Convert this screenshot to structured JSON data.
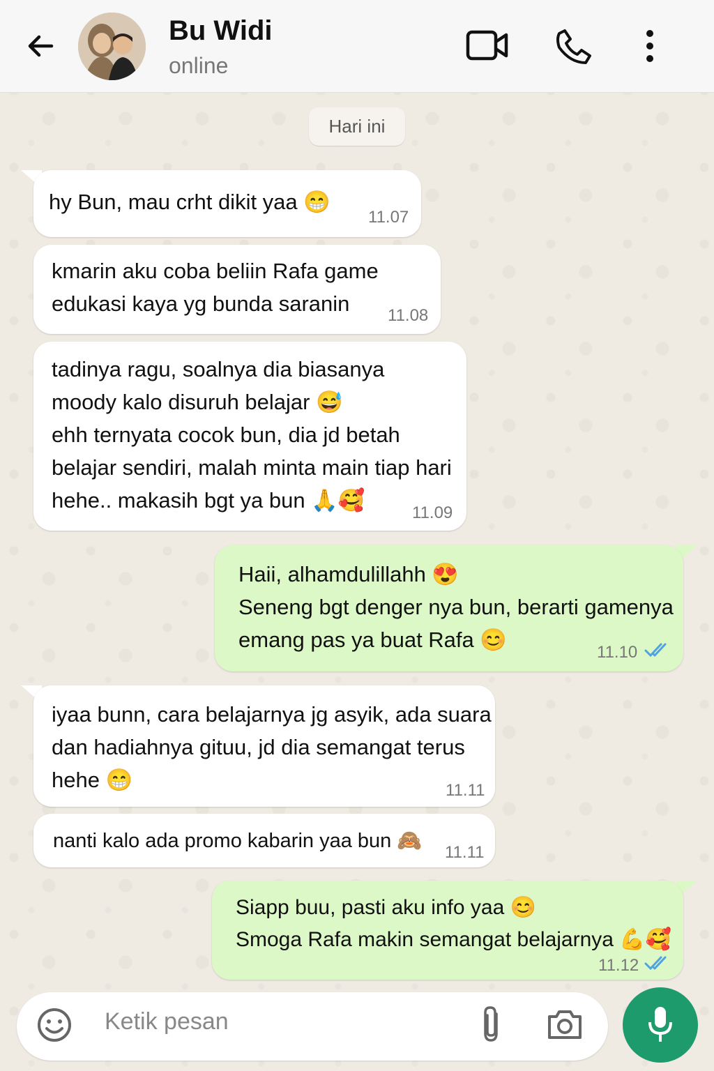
{
  "header": {
    "contact_name": "Bu Widi",
    "status": "online"
  },
  "date_chip": "Hari ini",
  "messages": [
    {
      "direction": "in",
      "text": "hy Bun, mau crht dikit yaa 😁",
      "time": "11.07"
    },
    {
      "direction": "in",
      "text": "kmarin aku coba beliin Rafa game\nedukasi kaya yg bunda saranin",
      "time": "11.08"
    },
    {
      "direction": "in",
      "text": "tadinya ragu, soalnya dia biasanya\nmoody kalo disuruh belajar 😅\nehh ternyata cocok bun, dia jd betah\nbelajar sendiri, malah minta main tiap hari\nhehe.. makasih bgt ya bun 🙏🥰",
      "time": "11.09"
    },
    {
      "direction": "out",
      "text": "Haii, alhamdulillahh 😍\nSeneng bgt denger nya bun, berarti gamenya\nemang pas ya buat Rafa 😊",
      "time": "11.10",
      "read": true
    },
    {
      "direction": "in",
      "text": "iyaa bunn, cara belajarnya jg asyik, ada suara\ndan hadiahnya gituu, jd dia semangat terus\nhehe 😁",
      "time": "11.11"
    },
    {
      "direction": "in",
      "text": "nanti kalo ada promo kabarin yaa bun 🙈",
      "time": "11.11"
    },
    {
      "direction": "out",
      "text": "Siapp buu, pasti aku info yaa 😊\nSmoga Rafa makin semangat belajarnya 💪🥰",
      "time": "11.12",
      "read": true
    }
  ],
  "input": {
    "placeholder": "Ketik pesan"
  },
  "colors": {
    "incoming_bubble": "#ffffff",
    "outgoing_bubble": "#dcf8c6",
    "read_ticks": "#4fa3e0",
    "mic_button": "#1d9b6c"
  }
}
